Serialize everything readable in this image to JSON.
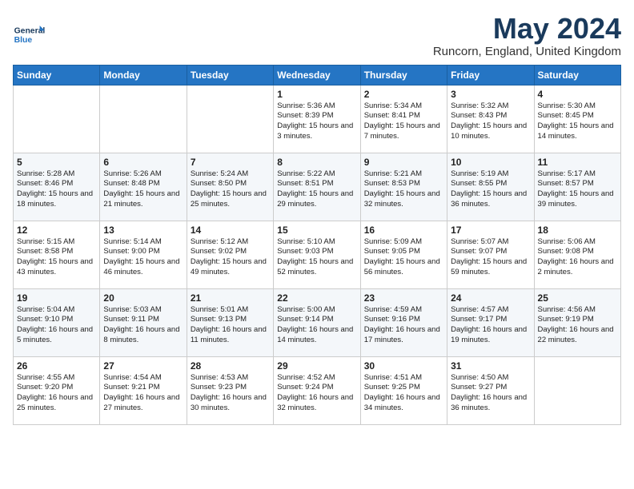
{
  "logo": {
    "general": "General",
    "blue": "Blue"
  },
  "title": {
    "month_year": "May 2024",
    "location": "Runcorn, England, United Kingdom"
  },
  "days_header": [
    "Sunday",
    "Monday",
    "Tuesday",
    "Wednesday",
    "Thursday",
    "Friday",
    "Saturday"
  ],
  "weeks": [
    [
      {
        "day": "",
        "info": ""
      },
      {
        "day": "",
        "info": ""
      },
      {
        "day": "",
        "info": ""
      },
      {
        "day": "1",
        "info": "Sunrise: 5:36 AM\nSunset: 8:39 PM\nDaylight: 15 hours\nand 3 minutes."
      },
      {
        "day": "2",
        "info": "Sunrise: 5:34 AM\nSunset: 8:41 PM\nDaylight: 15 hours\nand 7 minutes."
      },
      {
        "day": "3",
        "info": "Sunrise: 5:32 AM\nSunset: 8:43 PM\nDaylight: 15 hours\nand 10 minutes."
      },
      {
        "day": "4",
        "info": "Sunrise: 5:30 AM\nSunset: 8:45 PM\nDaylight: 15 hours\nand 14 minutes."
      }
    ],
    [
      {
        "day": "5",
        "info": "Sunrise: 5:28 AM\nSunset: 8:46 PM\nDaylight: 15 hours\nand 18 minutes."
      },
      {
        "day": "6",
        "info": "Sunrise: 5:26 AM\nSunset: 8:48 PM\nDaylight: 15 hours\nand 21 minutes."
      },
      {
        "day": "7",
        "info": "Sunrise: 5:24 AM\nSunset: 8:50 PM\nDaylight: 15 hours\nand 25 minutes."
      },
      {
        "day": "8",
        "info": "Sunrise: 5:22 AM\nSunset: 8:51 PM\nDaylight: 15 hours\nand 29 minutes."
      },
      {
        "day": "9",
        "info": "Sunrise: 5:21 AM\nSunset: 8:53 PM\nDaylight: 15 hours\nand 32 minutes."
      },
      {
        "day": "10",
        "info": "Sunrise: 5:19 AM\nSunset: 8:55 PM\nDaylight: 15 hours\nand 36 minutes."
      },
      {
        "day": "11",
        "info": "Sunrise: 5:17 AM\nSunset: 8:57 PM\nDaylight: 15 hours\nand 39 minutes."
      }
    ],
    [
      {
        "day": "12",
        "info": "Sunrise: 5:15 AM\nSunset: 8:58 PM\nDaylight: 15 hours\nand 43 minutes."
      },
      {
        "day": "13",
        "info": "Sunrise: 5:14 AM\nSunset: 9:00 PM\nDaylight: 15 hours\nand 46 minutes."
      },
      {
        "day": "14",
        "info": "Sunrise: 5:12 AM\nSunset: 9:02 PM\nDaylight: 15 hours\nand 49 minutes."
      },
      {
        "day": "15",
        "info": "Sunrise: 5:10 AM\nSunset: 9:03 PM\nDaylight: 15 hours\nand 52 minutes."
      },
      {
        "day": "16",
        "info": "Sunrise: 5:09 AM\nSunset: 9:05 PM\nDaylight: 15 hours\nand 56 minutes."
      },
      {
        "day": "17",
        "info": "Sunrise: 5:07 AM\nSunset: 9:07 PM\nDaylight: 15 hours\nand 59 minutes."
      },
      {
        "day": "18",
        "info": "Sunrise: 5:06 AM\nSunset: 9:08 PM\nDaylight: 16 hours\nand 2 minutes."
      }
    ],
    [
      {
        "day": "19",
        "info": "Sunrise: 5:04 AM\nSunset: 9:10 PM\nDaylight: 16 hours\nand 5 minutes."
      },
      {
        "day": "20",
        "info": "Sunrise: 5:03 AM\nSunset: 9:11 PM\nDaylight: 16 hours\nand 8 minutes."
      },
      {
        "day": "21",
        "info": "Sunrise: 5:01 AM\nSunset: 9:13 PM\nDaylight: 16 hours\nand 11 minutes."
      },
      {
        "day": "22",
        "info": "Sunrise: 5:00 AM\nSunset: 9:14 PM\nDaylight: 16 hours\nand 14 minutes."
      },
      {
        "day": "23",
        "info": "Sunrise: 4:59 AM\nSunset: 9:16 PM\nDaylight: 16 hours\nand 17 minutes."
      },
      {
        "day": "24",
        "info": "Sunrise: 4:57 AM\nSunset: 9:17 PM\nDaylight: 16 hours\nand 19 minutes."
      },
      {
        "day": "25",
        "info": "Sunrise: 4:56 AM\nSunset: 9:19 PM\nDaylight: 16 hours\nand 22 minutes."
      }
    ],
    [
      {
        "day": "26",
        "info": "Sunrise: 4:55 AM\nSunset: 9:20 PM\nDaylight: 16 hours\nand 25 minutes."
      },
      {
        "day": "27",
        "info": "Sunrise: 4:54 AM\nSunset: 9:21 PM\nDaylight: 16 hours\nand 27 minutes."
      },
      {
        "day": "28",
        "info": "Sunrise: 4:53 AM\nSunset: 9:23 PM\nDaylight: 16 hours\nand 30 minutes."
      },
      {
        "day": "29",
        "info": "Sunrise: 4:52 AM\nSunset: 9:24 PM\nDaylight: 16 hours\nand 32 minutes."
      },
      {
        "day": "30",
        "info": "Sunrise: 4:51 AM\nSunset: 9:25 PM\nDaylight: 16 hours\nand 34 minutes."
      },
      {
        "day": "31",
        "info": "Sunrise: 4:50 AM\nSunset: 9:27 PM\nDaylight: 16 hours\nand 36 minutes."
      },
      {
        "day": "",
        "info": ""
      }
    ]
  ]
}
